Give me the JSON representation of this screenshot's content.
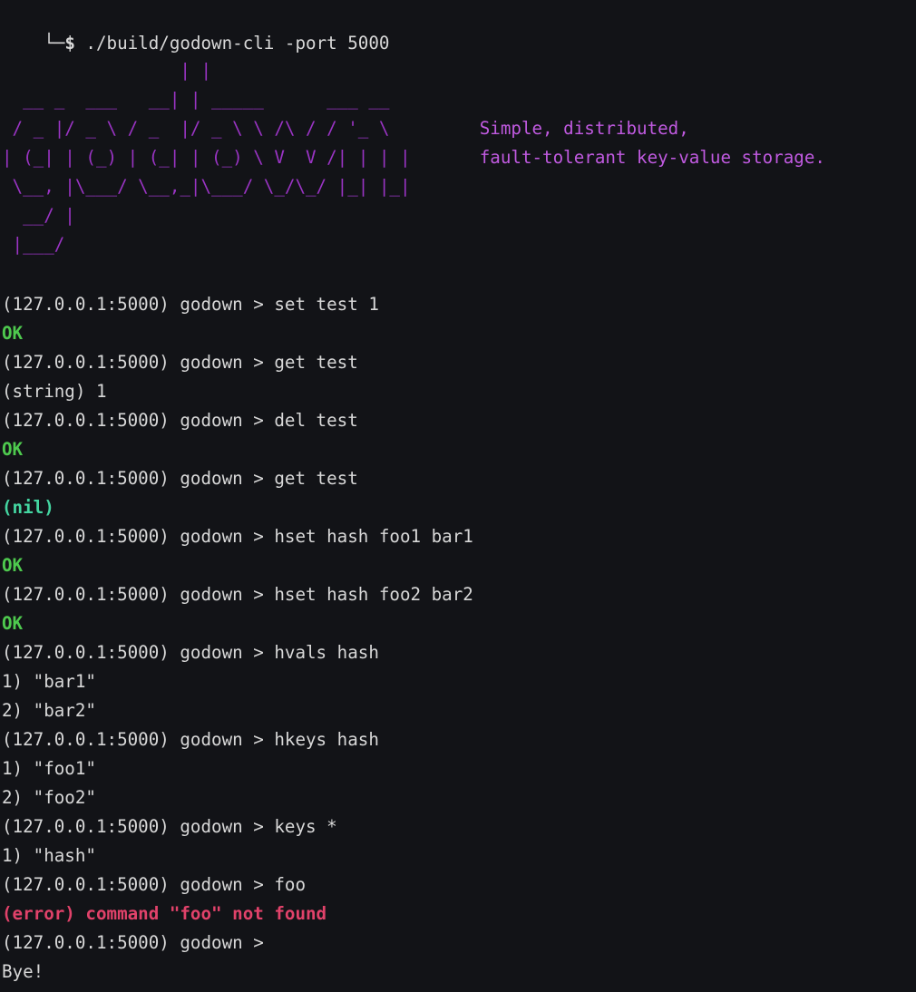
{
  "terminal": {
    "background_color": "#121317",
    "foreground_color": "#d8d8d8",
    "banner_color": "#9a34c4",
    "tagline_color": "#c05ae0",
    "ok_color": "#4ec94e",
    "nil_color": "#44d6a1",
    "error_color": "#e1426a",
    "shell_prompt_symbol": "└─$",
    "command": " ./build/godown-cli -port 5000"
  },
  "banner": {
    "art_lines": [
      "                 | |",
      "  __ _  ___   __| | _____      ___ __",
      " / _ |/ _ \\ / _  |/ _ \\ \\ /\\ / / '_ \\",
      "| (_| | (_) | (_| | (_) \\ V  V /| | | |",
      " \\__, |\\___/ \\__,_|\\___/ \\_/\\_/ |_| |_|",
      "  __/ |",
      " |___/"
    ],
    "tagline_lines": [
      "Simple, distributed,",
      "fault-tolerant key-value storage."
    ],
    "tagline_x_chars": 43,
    "tagline_start_row": 2
  },
  "session": {
    "prompt": "(127.0.0.1:5000) godown > ",
    "entries": [
      {
        "type": "prompt",
        "text": "(127.0.0.1:5000) godown > set test 1"
      },
      {
        "type": "ok",
        "text": "OK"
      },
      {
        "type": "prompt",
        "text": "(127.0.0.1:5000) godown > get test"
      },
      {
        "type": "default",
        "text": "(string) 1"
      },
      {
        "type": "prompt",
        "text": "(127.0.0.1:5000) godown > del test"
      },
      {
        "type": "ok",
        "text": "OK"
      },
      {
        "type": "prompt",
        "text": "(127.0.0.1:5000) godown > get test"
      },
      {
        "type": "nil",
        "text": "(nil)"
      },
      {
        "type": "prompt",
        "text": "(127.0.0.1:5000) godown > hset hash foo1 bar1"
      },
      {
        "type": "ok",
        "text": "OK"
      },
      {
        "type": "prompt",
        "text": "(127.0.0.1:5000) godown > hset hash foo2 bar2"
      },
      {
        "type": "ok",
        "text": "OK"
      },
      {
        "type": "prompt",
        "text": "(127.0.0.1:5000) godown > hvals hash"
      },
      {
        "type": "default",
        "text": "1) \"bar1\""
      },
      {
        "type": "default",
        "text": "2) \"bar2\""
      },
      {
        "type": "prompt",
        "text": "(127.0.0.1:5000) godown > hkeys hash"
      },
      {
        "type": "default",
        "text": "1) \"foo1\""
      },
      {
        "type": "default",
        "text": "2) \"foo2\""
      },
      {
        "type": "prompt",
        "text": "(127.0.0.1:5000) godown > keys *"
      },
      {
        "type": "default",
        "text": "1) \"hash\""
      },
      {
        "type": "prompt",
        "text": "(127.0.0.1:5000) godown > foo"
      },
      {
        "type": "error",
        "text": "(error) command \"foo\" not found"
      },
      {
        "type": "prompt",
        "text": "(127.0.0.1:5000) godown > "
      },
      {
        "type": "default",
        "text": "Bye!"
      }
    ]
  }
}
